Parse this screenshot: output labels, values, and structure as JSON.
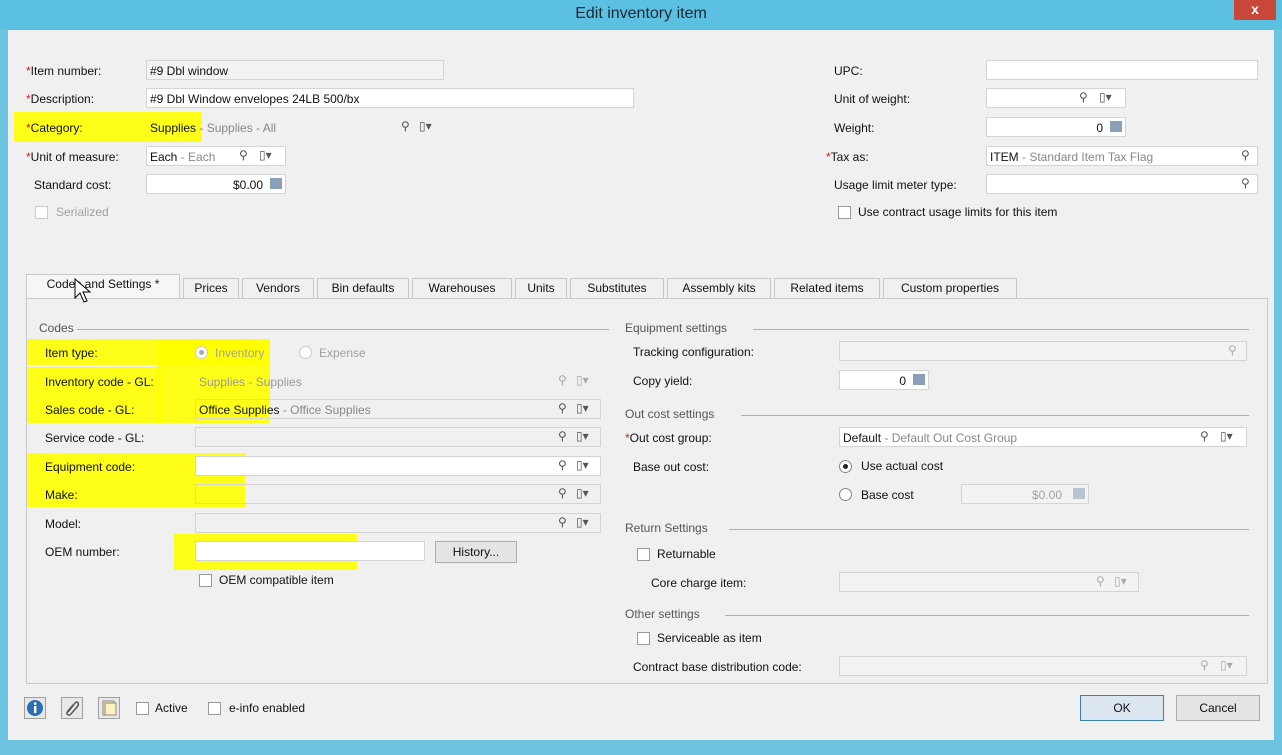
{
  "window": {
    "title": "Edit inventory item",
    "close": "x"
  },
  "header": {
    "item_number_label": "Item number:",
    "item_number": "#9 Dbl window",
    "description_label": "Description:",
    "description": "#9 Dbl Window envelopes 24LB  500/bx",
    "category_label": "Category:",
    "category_code": "Supplies",
    "category_desc": " - Supplies - All",
    "uom_label": "Unit of measure:",
    "uom_code": "Each",
    "uom_desc": " - Each",
    "standard_cost_label": "Standard cost:",
    "standard_cost": "$0.00",
    "serialized_label": "Serialized",
    "upc_label": "UPC:",
    "upc": "",
    "unit_of_weight_label": "Unit of weight:",
    "unit_of_weight": "",
    "weight_label": "Weight:",
    "weight": "0",
    "tax_as_label": "Tax as:",
    "tax_code": "ITEM",
    "tax_desc": " - Standard Item Tax Flag",
    "usage_limit_label": "Usage limit meter type:",
    "usage_limit": "",
    "contract_usage_label": "Use contract usage limits for this item",
    "required_mark": "*"
  },
  "tabs": [
    {
      "label": "Codes and Settings *"
    },
    {
      "label": "Prices"
    },
    {
      "label": "Vendors"
    },
    {
      "label": "Bin defaults"
    },
    {
      "label": "Warehouses"
    },
    {
      "label": "Units"
    },
    {
      "label": "Substitutes"
    },
    {
      "label": "Assembly kits"
    },
    {
      "label": "Related items"
    },
    {
      "label": "Custom properties"
    }
  ],
  "codes": {
    "group_label": "Codes",
    "item_type_label": "Item type:",
    "inventory_opt": "Inventory",
    "expense_opt": "Expense",
    "inventory_code_label": "Inventory code - GL:",
    "inventory_code": "Supplies",
    "inventory_desc": " - Supplies",
    "sales_code_label": "Sales code - GL:",
    "sales_code": "Office Supplies",
    "sales_desc": " - Office Supplies",
    "service_code_label": "Service code - GL:",
    "service_code": "",
    "equipment_code_label": "Equipment code:",
    "equipment_code": "",
    "make_label": "Make:",
    "make": "",
    "model_label": "Model:",
    "model": "",
    "oem_number_label": "OEM number:",
    "oem_number": "",
    "history_button": "History...",
    "oem_compatible_label": "OEM compatible item"
  },
  "equipment": {
    "group_label": "Equipment settings",
    "tracking_label": "Tracking configuration:",
    "tracking": "",
    "copy_yield_label": "Copy yield:",
    "copy_yield": "0"
  },
  "out_cost": {
    "group_label": "Out cost settings",
    "group_field_label": "Out cost group:",
    "group_code": "Default",
    "group_desc": " - Default Out Cost Group",
    "base_label": "Base out cost:",
    "use_actual": "Use actual cost",
    "base_cost": "Base cost",
    "base_cost_value": "$0.00"
  },
  "return": {
    "group_label": "Return Settings",
    "returnable_label": "Returnable",
    "core_charge_label": "Core charge item:",
    "core_charge": ""
  },
  "other": {
    "group_label": "Other settings",
    "serviceable_label": "Serviceable as item",
    "contract_dist_label": "Contract base distribution code:",
    "contract_dist": ""
  },
  "footer": {
    "active_label": "Active",
    "einfo_label": "e-info enabled",
    "ok_button": "OK",
    "cancel_button": "Cancel"
  },
  "icons": {
    "lookup": "⚲",
    "details": "▯▾",
    "calendar": "▦"
  },
  "colors": {
    "highlight": "#ffff00",
    "titlebar": "#5cc0e2",
    "close": "#c8473a"
  }
}
